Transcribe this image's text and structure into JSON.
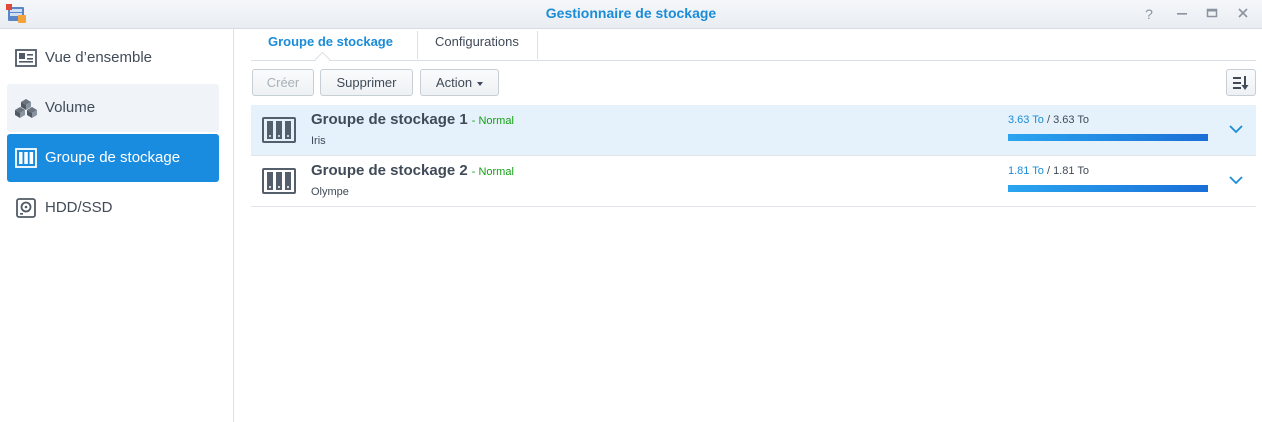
{
  "window": {
    "title": "Gestionnaire de stockage"
  },
  "sidebar": {
    "items": [
      {
        "label": "Vue d’ensemble",
        "icon": "overview-icon"
      },
      {
        "label": "Volume",
        "icon": "volume-cubes-icon"
      },
      {
        "label": "Groupe de stockage",
        "icon": "storage-pool-icon"
      },
      {
        "label": "HDD/SSD",
        "icon": "disk-icon"
      }
    ]
  },
  "tabs": [
    {
      "label": "Groupe de stockage",
      "active": true
    },
    {
      "label": "Configurations",
      "active": false
    }
  ],
  "toolbar": {
    "create_label": "Créer",
    "delete_label": "Supprimer",
    "action_label": "Action"
  },
  "pools": [
    {
      "name": "Groupe de stockage 1",
      "status": "- Normal",
      "subtitle": "Iris",
      "used": "3.63 To",
      "total": "/ 3.63 To",
      "fraction": 1.0
    },
    {
      "name": "Groupe de stockage 2",
      "status": "- Normal",
      "subtitle": "Olympe",
      "used": "1.81 To",
      "total": "/ 1.81 To",
      "fraction": 1.0
    }
  ],
  "colors": {
    "accent": "#1a8ce0",
    "status_ok": "#15a015"
  }
}
